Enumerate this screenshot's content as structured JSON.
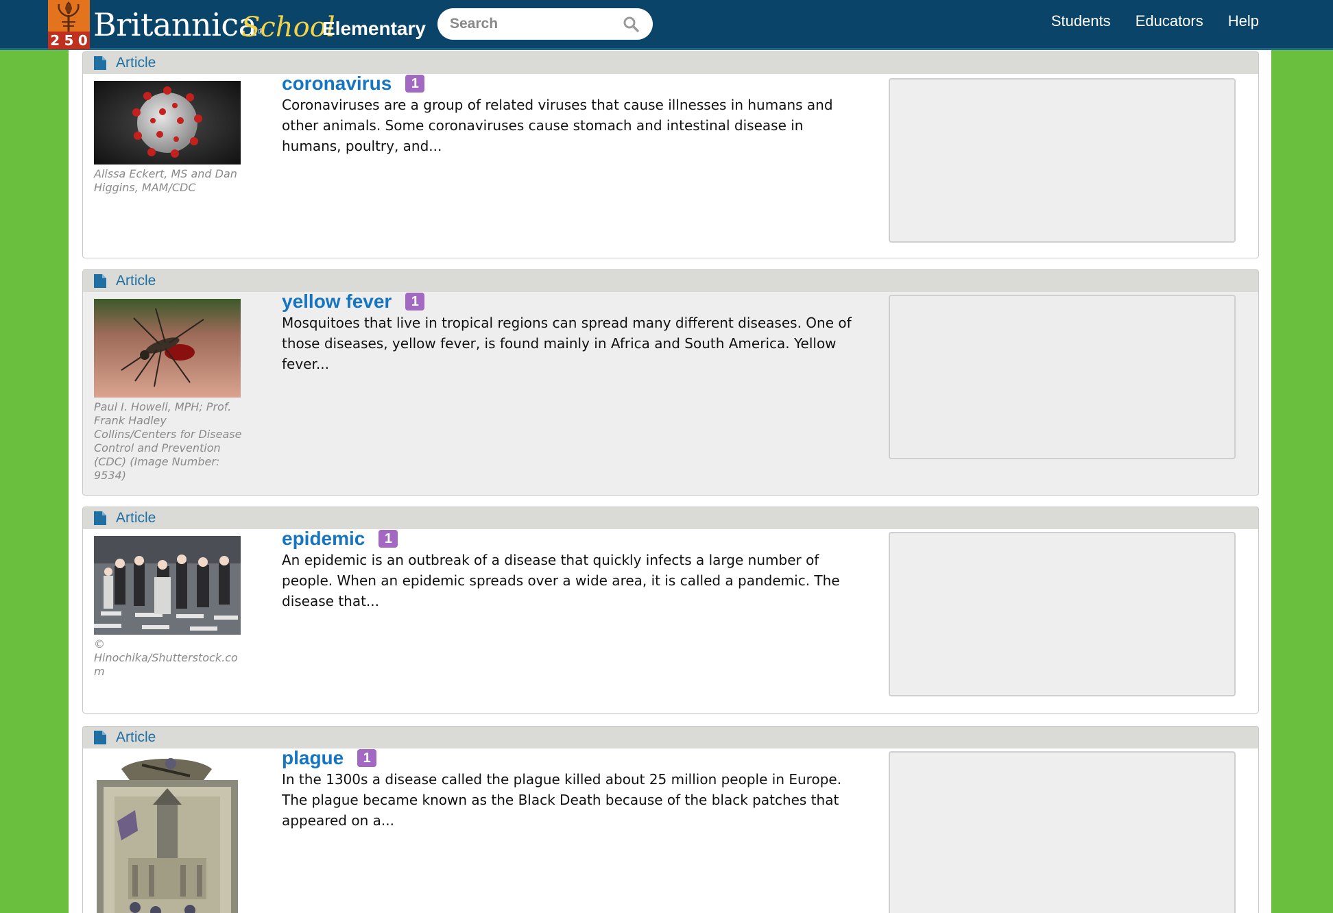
{
  "header": {
    "logo_digits": [
      "2",
      "5",
      "0"
    ],
    "brand": "Britannica",
    "brand_mark": "®",
    "brand_school": "School",
    "level": "Elementary",
    "search_placeholder": "Search",
    "nav": [
      "Students",
      "Educators",
      "Help"
    ]
  },
  "results": [
    {
      "type": "Article",
      "title": "coronavirus",
      "badge": "1",
      "snippet": "Coronaviruses are a group of related viruses that cause illnesses in humans and other animals. Some coronaviruses cause stomach and intestinal disease in humans, poultry, and...",
      "image_credit": "Alissa Eckert, MS and Dan Higgins, MAM/CDC"
    },
    {
      "type": "Article",
      "title": "yellow fever",
      "badge": "1",
      "snippet": "Mosquitoes that live in tropical regions can spread many different diseases. One of those diseases, yellow fever, is found mainly in Africa and South America. Yellow fever...",
      "image_credit": "Paul I. Howell, MPH; Prof. Frank Hadley Collins/Centers for Disease Control and Prevention (CDC) (Image Number: 9534)"
    },
    {
      "type": "Article",
      "title": "epidemic",
      "badge": "1",
      "snippet": "An epidemic is an outbreak of a disease that quickly infects a large number of people. When an epidemic spreads over a wide area, it is called a pandemic. The disease that...",
      "image_credit": "© Hinochika/Shutterstock.com"
    },
    {
      "type": "Article",
      "title": "plague",
      "badge": "1",
      "snippet": "In the 1300s a disease called the plague killed about 25 million people in Europe. The plague became known as the Black Death because of the black patches that appeared on a...",
      "image_credit": ""
    }
  ],
  "colors": {
    "header_bg": "#0a4569",
    "page_bg": "#6abf3e",
    "title_link": "#1575c1",
    "badge": "#a268c2",
    "card_header": "#dadad6"
  }
}
